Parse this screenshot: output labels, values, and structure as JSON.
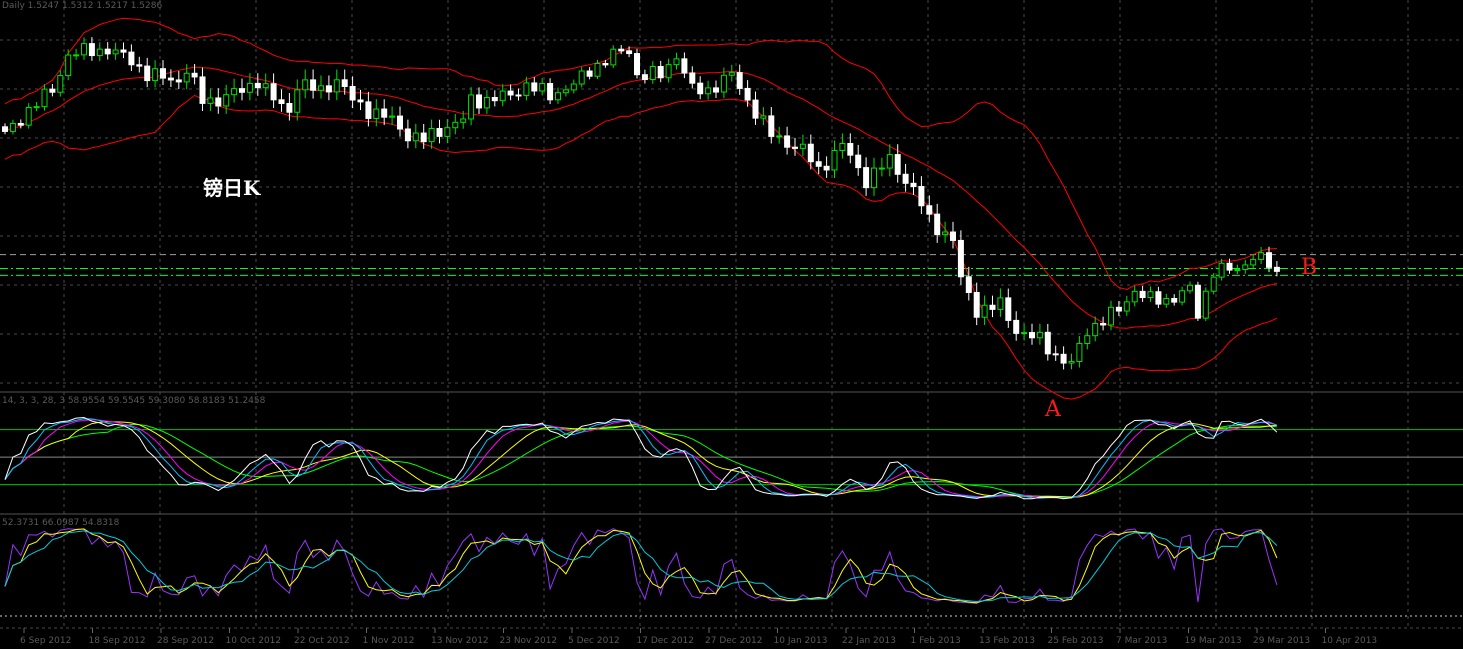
{
  "header": {
    "symbol_info": "Daily 1.5247 1.5312 1.5217 1.5286"
  },
  "annotations": {
    "title": "镑日K",
    "point_a": "A",
    "point_b": "B"
  },
  "indicator1": {
    "info": "14, 3, 3, 28, 3 58.9554 59.5545 59.3080 58.8183 51.2458",
    "levels": [
      80,
      50,
      20
    ]
  },
  "indicator2": {
    "info": "52.3731 66.0987 54.8318"
  },
  "colors": {
    "bull": "#00e000",
    "bear": "#ffffff",
    "band": "#ff0000",
    "grid": "#4a4a4a",
    "level_green": "#00c000",
    "hline_gray": "#a0a0a0",
    "hline_green": "#00ff00",
    "k_line": "#ffffff",
    "d_line": "#00bfff",
    "ma1": "#ff00ff",
    "ma2": "#ffff00",
    "ma3": "#00ff00",
    "fast": "#9933ff",
    "mid": "#ffff00",
    "slow": "#00ccdd"
  },
  "chart_data": {
    "type": "candlestick",
    "title": "GBPUSD Daily",
    "bars": 162,
    "anchor_bar": [
      0,
      3,
      6,
      8,
      11,
      13,
      16,
      18,
      22,
      23,
      25,
      27,
      30,
      32,
      34,
      36,
      37,
      40,
      42,
      44,
      46,
      49,
      51,
      53,
      55,
      58,
      59,
      61,
      64,
      66,
      69,
      72,
      74,
      77,
      79,
      80,
      83,
      85,
      87,
      89,
      92,
      94,
      97,
      101,
      103,
      106,
      109,
      112,
      115,
      117,
      120,
      121,
      123,
      126,
      128,
      131,
      133,
      135,
      137,
      139,
      141,
      143,
      145,
      147,
      150,
      151,
      153,
      156,
      158,
      160,
      161
    ],
    "anchor_close": [
      1.589,
      1.5998,
      1.6084,
      1.6235,
      1.6257,
      1.6257,
      1.6214,
      1.6149,
      1.6127,
      1.617,
      1.6041,
      1.6041,
      1.6084,
      1.6127,
      1.6041,
      1.5998,
      1.6106,
      1.6084,
      1.6127,
      1.6041,
      1.5998,
      1.5954,
      1.589,
      1.5868,
      1.5911,
      1.5954,
      1.6041,
      1.6041,
      1.6062,
      1.6106,
      1.6062,
      1.6106,
      1.617,
      1.6235,
      1.6257,
      1.6149,
      1.6149,
      1.6235,
      1.6084,
      1.6084,
      1.6149,
      1.6041,
      1.589,
      1.5825,
      1.5738,
      1.5846,
      1.5695,
      1.5782,
      1.5652,
      1.5522,
      1.5436,
      1.5263,
      1.5134,
      1.5155,
      1.5047,
      1.5004,
      1.4939,
      1.4896,
      1.5047,
      1.509,
      1.5134,
      1.522,
      1.5177,
      1.5177,
      1.522,
      1.5112,
      1.5306,
      1.5306,
      1.5371,
      1.5328,
      1.5286
    ],
    "price_range": [
      1.46,
      1.647
    ],
    "bollinger": {
      "period": 20,
      "deviation": 2
    },
    "horizontal_lines": [
      {
        "price": 1.5373,
        "style": "dashed-gray"
      },
      {
        "price": 1.5313,
        "style": "dashdot-green"
      },
      {
        "price": 1.5283,
        "style": "dashdot-green"
      }
    ],
    "x_ticks": [
      "6 Sep 2012",
      "18 Sep 2012",
      "28 Sep 2012",
      "10 Oct 2012",
      "22 Oct 2012",
      "1 Nov 2012",
      "13 Nov 2012",
      "23 Nov 2012",
      "5 Dec 2012",
      "17 Dec 2012",
      "27 Dec 2012",
      "10 Jan 2013",
      "22 Jan 2013",
      "1 Feb 2013",
      "13 Feb 2013",
      "25 Feb 2013",
      "7 Mar 2013",
      "19 Mar 2013",
      "29 Mar 2013",
      "10 Apr 2013"
    ]
  }
}
